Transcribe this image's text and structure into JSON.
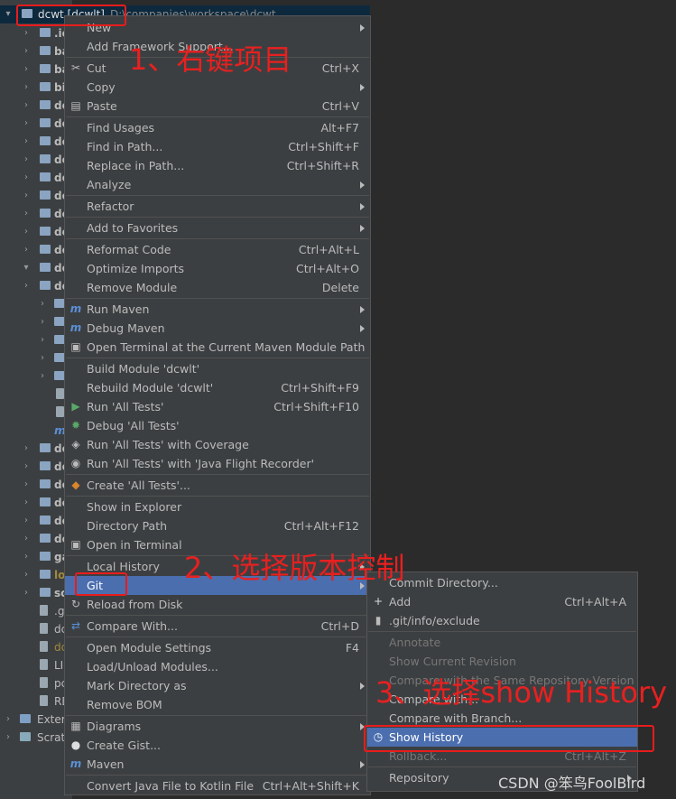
{
  "project": {
    "root_label": "dcwt [dcwlt]",
    "root_path": "D:\\companies\\workspace\\dcwt",
    "tree_items": [
      {
        "label": ".ic",
        "type": "folder"
      },
      {
        "label": "ba",
        "type": "folder"
      },
      {
        "label": "ba",
        "type": "folder"
      },
      {
        "label": "bi",
        "type": "folder"
      },
      {
        "label": "dc",
        "type": "folder"
      },
      {
        "label": "dc",
        "type": "folder"
      },
      {
        "label": "dc",
        "type": "folder"
      },
      {
        "label": "dc",
        "type": "folder"
      },
      {
        "label": "dc",
        "type": "folder"
      },
      {
        "label": "dc",
        "type": "folder"
      },
      {
        "label": "dc",
        "type": "folder"
      },
      {
        "label": "dc",
        "type": "folder"
      },
      {
        "label": "dc",
        "type": "folder"
      },
      {
        "label": "dc",
        "type": "folder"
      },
      {
        "label": "dc",
        "type": "folder"
      }
    ],
    "bottom_items": [
      {
        "label": "dc"
      },
      {
        "label": "dc"
      },
      {
        "label": "dc"
      },
      {
        "label": "dc"
      },
      {
        "label": "dc"
      },
      {
        "label": "dc"
      },
      {
        "label": "ga"
      },
      {
        "label": "lo"
      },
      {
        "label": "sc"
      },
      {
        "label": ".g"
      },
      {
        "label": "dc"
      },
      {
        "label": "dc"
      },
      {
        "label": "LI"
      },
      {
        "label": "pc"
      },
      {
        "label": "RE"
      }
    ],
    "external_label": "Exter",
    "scratch_label": "Scrat"
  },
  "context_menu": {
    "items": [
      {
        "label": "New",
        "shortcut": "",
        "submenu": true,
        "icon": ""
      },
      {
        "label": "Add Framework Support...",
        "shortcut": "",
        "submenu": false,
        "icon": ""
      },
      {
        "sep": true
      },
      {
        "label": "Cut",
        "shortcut": "Ctrl+X",
        "submenu": false,
        "icon": "scissors-icon"
      },
      {
        "label": "Copy",
        "shortcut": "",
        "submenu": true,
        "icon": ""
      },
      {
        "label": "Paste",
        "shortcut": "Ctrl+V",
        "submenu": false,
        "icon": "clipboard-icon"
      },
      {
        "sep": true
      },
      {
        "label": "Find Usages",
        "shortcut": "Alt+F7",
        "submenu": false,
        "icon": ""
      },
      {
        "label": "Find in Path...",
        "shortcut": "Ctrl+Shift+F",
        "submenu": false,
        "icon": ""
      },
      {
        "label": "Replace in Path...",
        "shortcut": "Ctrl+Shift+R",
        "submenu": false,
        "icon": ""
      },
      {
        "label": "Analyze",
        "shortcut": "",
        "submenu": true,
        "icon": ""
      },
      {
        "sep": true
      },
      {
        "label": "Refactor",
        "shortcut": "",
        "submenu": true,
        "icon": ""
      },
      {
        "sep": true
      },
      {
        "label": "Add to Favorites",
        "shortcut": "",
        "submenu": true,
        "icon": ""
      },
      {
        "sep": true
      },
      {
        "label": "Reformat Code",
        "shortcut": "Ctrl+Alt+L",
        "submenu": false,
        "icon": ""
      },
      {
        "label": "Optimize Imports",
        "shortcut": "Ctrl+Alt+O",
        "submenu": false,
        "icon": ""
      },
      {
        "label": "Remove Module",
        "shortcut": "Delete",
        "submenu": false,
        "icon": ""
      },
      {
        "sep": true
      },
      {
        "label": "Run Maven",
        "shortcut": "",
        "submenu": true,
        "icon": "maven-icon"
      },
      {
        "label": "Debug Maven",
        "shortcut": "",
        "submenu": true,
        "icon": "maven-debug-icon"
      },
      {
        "label": "Open Terminal at the Current Maven Module Path",
        "shortcut": "",
        "submenu": false,
        "icon": "terminal-icon"
      },
      {
        "sep": true
      },
      {
        "label": "Build Module 'dcwlt'",
        "shortcut": "",
        "submenu": false,
        "icon": ""
      },
      {
        "label": "Rebuild Module 'dcwlt'",
        "shortcut": "Ctrl+Shift+F9",
        "submenu": false,
        "icon": ""
      },
      {
        "label": "Run 'All Tests'",
        "shortcut": "Ctrl+Shift+F10",
        "submenu": false,
        "icon": "run-icon"
      },
      {
        "label": "Debug 'All Tests'",
        "shortcut": "",
        "submenu": false,
        "icon": "debug-icon"
      },
      {
        "label": "Run 'All Tests' with Coverage",
        "shortcut": "",
        "submenu": false,
        "icon": "coverage-icon"
      },
      {
        "label": "Run 'All Tests' with 'Java Flight Recorder'",
        "shortcut": "",
        "submenu": false,
        "icon": "profiler-icon"
      },
      {
        "sep": true
      },
      {
        "label": "Create 'All Tests'...",
        "shortcut": "",
        "submenu": false,
        "icon": "create-test-icon"
      },
      {
        "sep": true
      },
      {
        "label": "Show in Explorer",
        "shortcut": "",
        "submenu": false,
        "icon": ""
      },
      {
        "label": "Directory Path",
        "shortcut": "Ctrl+Alt+F12",
        "submenu": false,
        "icon": ""
      },
      {
        "label": "Open in Terminal",
        "shortcut": "",
        "submenu": false,
        "icon": "terminal-icon"
      },
      {
        "sep": true
      },
      {
        "label": "Local History",
        "shortcut": "",
        "submenu": true,
        "icon": ""
      },
      {
        "label": "Git",
        "shortcut": "",
        "submenu": true,
        "icon": "",
        "selected": true
      },
      {
        "label": "Reload from Disk",
        "shortcut": "",
        "submenu": false,
        "icon": "reload-icon"
      },
      {
        "sep": true
      },
      {
        "label": "Compare With...",
        "shortcut": "Ctrl+D",
        "submenu": false,
        "icon": "compare-icon"
      },
      {
        "sep": true
      },
      {
        "label": "Open Module Settings",
        "shortcut": "F4",
        "submenu": false,
        "icon": ""
      },
      {
        "label": "Load/Unload Modules...",
        "shortcut": "",
        "submenu": false,
        "icon": ""
      },
      {
        "label": "Mark Directory as",
        "shortcut": "",
        "submenu": true,
        "icon": ""
      },
      {
        "label": "Remove BOM",
        "shortcut": "",
        "submenu": false,
        "icon": ""
      },
      {
        "sep": true
      },
      {
        "label": "Diagrams",
        "shortcut": "",
        "submenu": true,
        "icon": "diagram-icon"
      },
      {
        "label": "Create Gist...",
        "shortcut": "",
        "submenu": false,
        "icon": "github-icon"
      },
      {
        "label": "Maven",
        "shortcut": "",
        "submenu": true,
        "icon": "maven-icon"
      },
      {
        "sep": true
      },
      {
        "label": "Convert Java File to Kotlin File",
        "shortcut": "Ctrl+Alt+Shift+K",
        "submenu": false,
        "icon": ""
      }
    ]
  },
  "git_submenu": {
    "items": [
      {
        "label": "Commit Directory...",
        "shortcut": "",
        "submenu": false,
        "icon": ""
      },
      {
        "label": "Add",
        "shortcut": "Ctrl+Alt+A",
        "submenu": false,
        "icon": "plus-icon"
      },
      {
        "label": ".git/info/exclude",
        "shortcut": "",
        "submenu": false,
        "icon": "git-file-icon"
      },
      {
        "sep": true
      },
      {
        "label": "Annotate",
        "shortcut": "",
        "submenu": false,
        "icon": "",
        "disabled": true
      },
      {
        "label": "Show Current Revision",
        "shortcut": "",
        "submenu": false,
        "icon": "",
        "disabled": true
      },
      {
        "label": "Compare with the Same Repository Version",
        "shortcut": "",
        "submenu": false,
        "icon": "",
        "disabled": true
      },
      {
        "label": "Compare with...",
        "shortcut": "",
        "submenu": false,
        "icon": ""
      },
      {
        "label": "Compare with Branch...",
        "shortcut": "",
        "submenu": false,
        "icon": ""
      },
      {
        "label": "Show History",
        "shortcut": "",
        "submenu": false,
        "icon": "clock-icon",
        "selected": true
      },
      {
        "label": "Rollback...",
        "shortcut": "Ctrl+Alt+Z",
        "submenu": false,
        "icon": "",
        "disabled": true
      },
      {
        "sep": true
      },
      {
        "label": "Repository",
        "shortcut": "",
        "submenu": true,
        "icon": ""
      }
    ]
  },
  "annotations": {
    "step1": "1、右键项目",
    "step2": "2、选择版本控制",
    "step3": "3、选择show History"
  },
  "watermark": "CSDN @笨鸟FoolBird",
  "colors": {
    "accent": "#4b6eaf",
    "annotation": "#e81c1c",
    "menu_bg": "#3c3f41"
  }
}
